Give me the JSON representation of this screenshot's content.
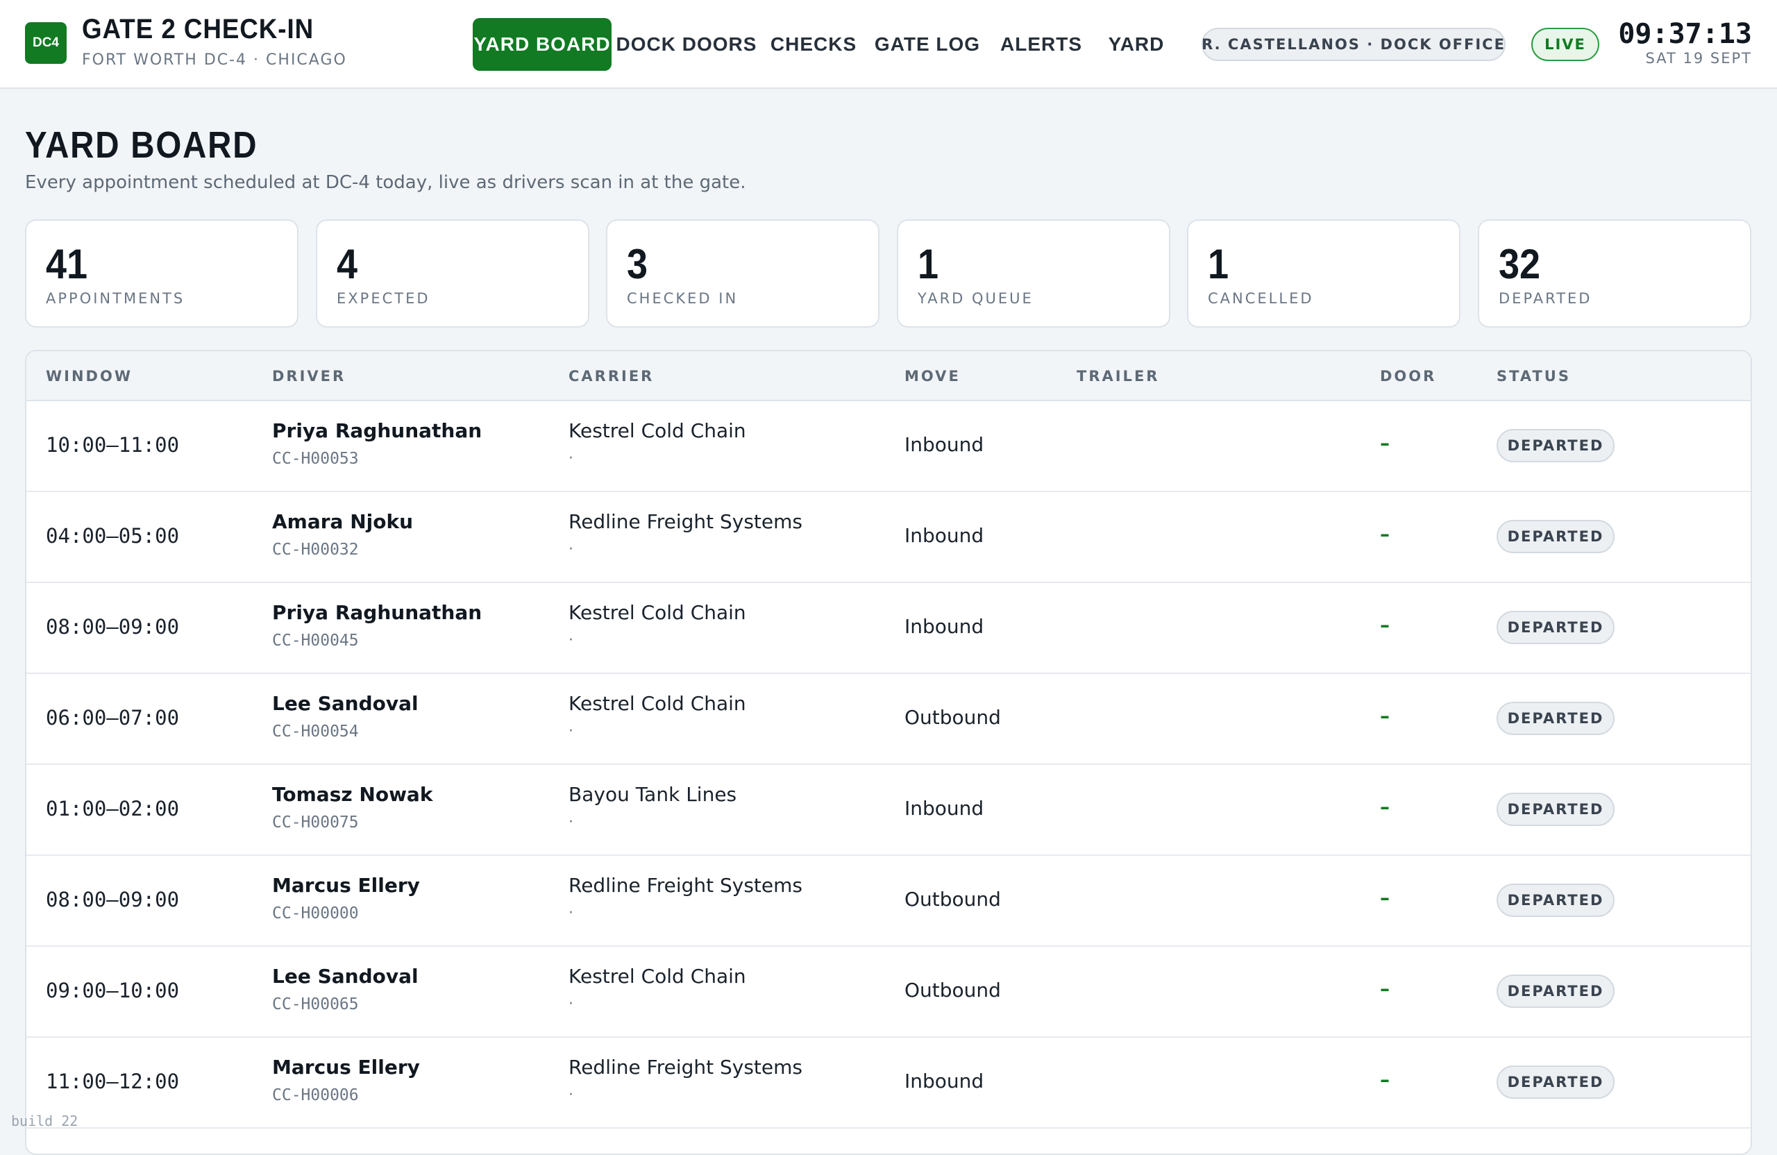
{
  "header": {
    "logo_text": "DC4",
    "title": "GATE 2 CHECK-IN",
    "subtitle": "FORT WORTH DC-4 · CHICAGO",
    "nav": [
      {
        "label": "YARD BOARD",
        "active": true
      },
      {
        "label": "DOCK DOORS",
        "active": false
      },
      {
        "label": "CHECKS",
        "active": false
      },
      {
        "label": "GATE LOG",
        "active": false
      },
      {
        "label": "ALERTS",
        "active": false
      },
      {
        "label": "YARD",
        "active": false
      }
    ],
    "user": "R. CASTELLANOS · DOCK OFFICE",
    "live": "LIVE",
    "time": "09:37:13",
    "date": "SAT 19 SEPT"
  },
  "page": {
    "title": "YARD BOARD",
    "subtitle": "Every appointment scheduled at DC-4 today, live as drivers scan in at the gate."
  },
  "stats": [
    {
      "value": "41",
      "label": "APPOINTMENTS"
    },
    {
      "value": "4",
      "label": "EXPECTED"
    },
    {
      "value": "3",
      "label": "CHECKED IN"
    },
    {
      "value": "1",
      "label": "YARD QUEUE"
    },
    {
      "value": "1",
      "label": "CANCELLED"
    },
    {
      "value": "32",
      "label": "DEPARTED"
    }
  ],
  "table": {
    "columns": [
      "WINDOW",
      "DRIVER",
      "CARRIER",
      "MOVE",
      "TRAILER",
      "DOOR",
      "STATUS"
    ],
    "rows": [
      {
        "window": "10:00–11:00",
        "driver": "Priya Raghunathan",
        "driver_id": "CC-H00053",
        "carrier": "Kestrel Cold Chain",
        "carrier_sub": "·",
        "move": "Inbound",
        "trailer": "",
        "door": "–",
        "status": "DEPARTED"
      },
      {
        "window": "04:00–05:00",
        "driver": "Amara Njoku",
        "driver_id": "CC-H00032",
        "carrier": "Redline Freight Systems",
        "carrier_sub": "·",
        "move": "Inbound",
        "trailer": "",
        "door": "–",
        "status": "DEPARTED"
      },
      {
        "window": "08:00–09:00",
        "driver": "Priya Raghunathan",
        "driver_id": "CC-H00045",
        "carrier": "Kestrel Cold Chain",
        "carrier_sub": "·",
        "move": "Inbound",
        "trailer": "",
        "door": "–",
        "status": "DEPARTED"
      },
      {
        "window": "06:00–07:00",
        "driver": "Lee Sandoval",
        "driver_id": "CC-H00054",
        "carrier": "Kestrel Cold Chain",
        "carrier_sub": "·",
        "move": "Outbound",
        "trailer": "",
        "door": "–",
        "status": "DEPARTED"
      },
      {
        "window": "01:00–02:00",
        "driver": "Tomasz Nowak",
        "driver_id": "CC-H00075",
        "carrier": "Bayou Tank Lines",
        "carrier_sub": "·",
        "move": "Inbound",
        "trailer": "",
        "door": "–",
        "status": "DEPARTED"
      },
      {
        "window": "08:00–09:00",
        "driver": "Marcus Ellery",
        "driver_id": "CC-H00000",
        "carrier": "Redline Freight Systems",
        "carrier_sub": "·",
        "move": "Outbound",
        "trailer": "",
        "door": "–",
        "status": "DEPARTED"
      },
      {
        "window": "09:00–10:00",
        "driver": "Lee Sandoval",
        "driver_id": "CC-H00065",
        "carrier": "Kestrel Cold Chain",
        "carrier_sub": "·",
        "move": "Outbound",
        "trailer": "",
        "door": "–",
        "status": "DEPARTED"
      },
      {
        "window": "11:00–12:00",
        "driver": "Marcus Ellery",
        "driver_id": "CC-H00006",
        "carrier": "Redline Freight Systems",
        "carrier_sub": "·",
        "move": "Inbound",
        "trailer": "",
        "door": "–",
        "status": "DEPARTED"
      }
    ]
  },
  "footer": {
    "build": "build 22"
  },
  "colors": {
    "accent": "#117a22",
    "background": "#f2f5f8"
  }
}
